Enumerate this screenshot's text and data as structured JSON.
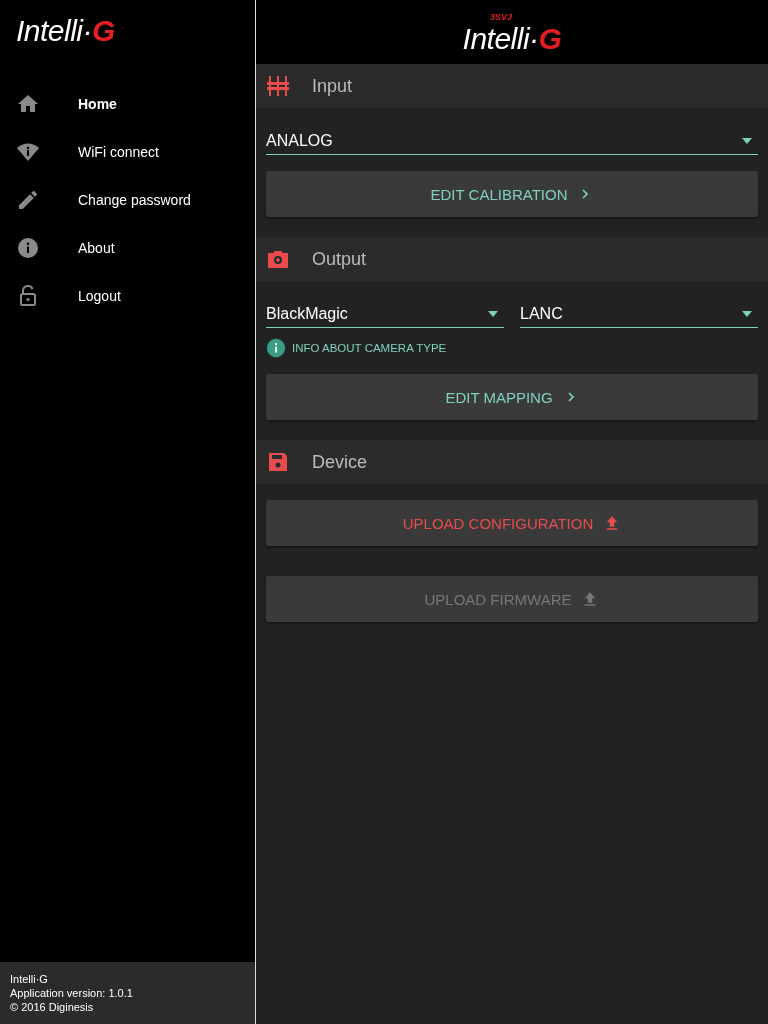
{
  "sidebar": {
    "logo": {
      "text": "Intelli·",
      "accent": "G"
    },
    "items": [
      {
        "label": "Home",
        "selected": true
      },
      {
        "label": "WiFi connect",
        "selected": false
      },
      {
        "label": "Change password",
        "selected": false
      },
      {
        "label": "About",
        "selected": false
      },
      {
        "label": "Logout",
        "selected": false
      }
    ],
    "footer": [
      "Intelli·G",
      "Application version: 1.0.1",
      "© 2016 Diginesis"
    ]
  },
  "header": {
    "logo_tag": "3SVJ",
    "logo": {
      "text": "Intelli·",
      "accent": "G"
    }
  },
  "sections": [
    {
      "title": "Input",
      "selects": [
        {
          "value": "ANALOG"
        }
      ],
      "buttons": [
        {
          "label": "EDIT CALIBRATION",
          "kind": "navigate",
          "color": "#7fd1bd",
          "disabled": false
        }
      ]
    },
    {
      "title": "Output",
      "selects": [
        {
          "value": "BlackMagic"
        },
        {
          "value": "LANC"
        }
      ],
      "info": "INFO ABOUT CAMERA TYPE",
      "buttons": [
        {
          "label": "EDIT MAPPING",
          "kind": "navigate",
          "color": "#7fd1bd",
          "disabled": false
        }
      ]
    },
    {
      "title": "Device",
      "buttons": [
        {
          "label": "UPLOAD CONFIGURATION",
          "kind": "upload",
          "color": "#e84c4c",
          "disabled": false
        },
        {
          "label": "UPLOAD FIRMWARE",
          "kind": "upload",
          "disabled": true
        }
      ]
    }
  ]
}
